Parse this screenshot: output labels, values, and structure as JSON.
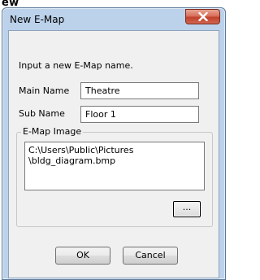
{
  "background_text": "ew",
  "window": {
    "title": "New E-Map",
    "close_icon": "close-x-icon"
  },
  "form": {
    "prompt": "Input a new E-Map name.",
    "main_name_label": "Main Name",
    "main_name_value": "Theatre",
    "sub_name_label": "Sub Name",
    "sub_name_value": "Floor 1",
    "image_group_label": "E-Map Image",
    "image_path_line1": "C:\\Users\\Public\\Pictures",
    "image_path_line2": "\\bldg_diagram.bmp",
    "browse_label": "..."
  },
  "buttons": {
    "ok_label": "OK",
    "cancel_label": "Cancel"
  },
  "colors": {
    "close_button": "#c1412c",
    "frame": "#bcd2ea",
    "client": "#f0f0f0"
  }
}
